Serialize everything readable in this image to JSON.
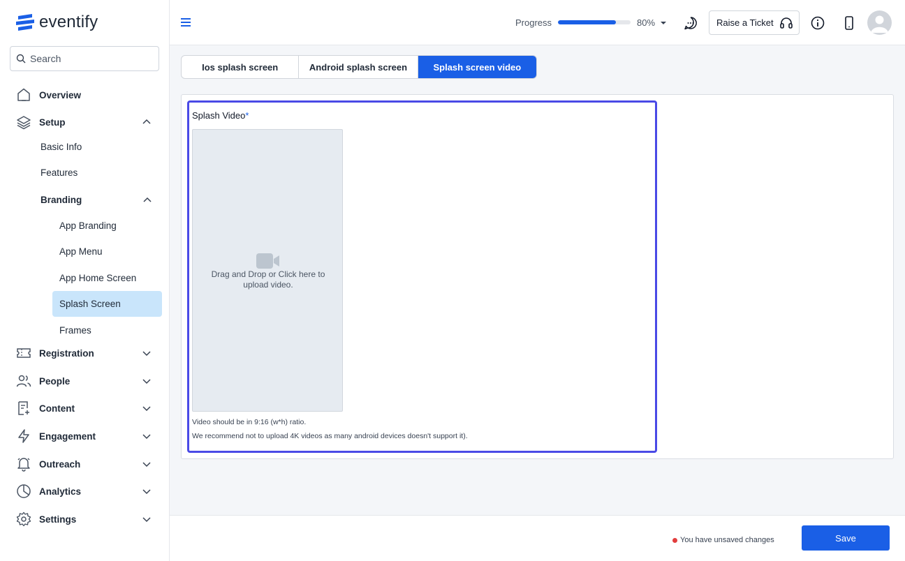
{
  "brand": {
    "name": "eventify",
    "accent": "#1a5fe6"
  },
  "search": {
    "placeholder": "Search"
  },
  "sidebar": {
    "overview": "Overview",
    "setup": "Setup",
    "basic_info": "Basic Info",
    "features": "Features",
    "branding": "Branding",
    "app_branding": "App Branding",
    "app_menu": "App Menu",
    "app_home_screen": "App Home Screen",
    "splash_screen": "Splash Screen",
    "frames": "Frames",
    "registration": "Registration",
    "people": "People",
    "content": "Content",
    "engagement": "Engagement",
    "outreach": "Outreach",
    "analytics": "Analytics",
    "settings": "Settings"
  },
  "header": {
    "progress_label": "Progress",
    "progress_value": 0.8,
    "progress_text": "80%",
    "ticket_label": "Raise a Ticket"
  },
  "tabs": [
    {
      "label": "Ios splash screen"
    },
    {
      "label": "Android splash screen"
    },
    {
      "label": "Splash screen video"
    }
  ],
  "upload": {
    "label": "Splash Video",
    "required_mark": "*",
    "prompt": "Drag and Drop or Click here to upload video.",
    "hint1": "Video should be in 9:16 (w*h) ratio.",
    "hint2": "We recommend not to upload 4K videos as many android devices doesn't support it)."
  },
  "footer": {
    "unsaved": "You have unsaved changes",
    "save": "Save"
  }
}
